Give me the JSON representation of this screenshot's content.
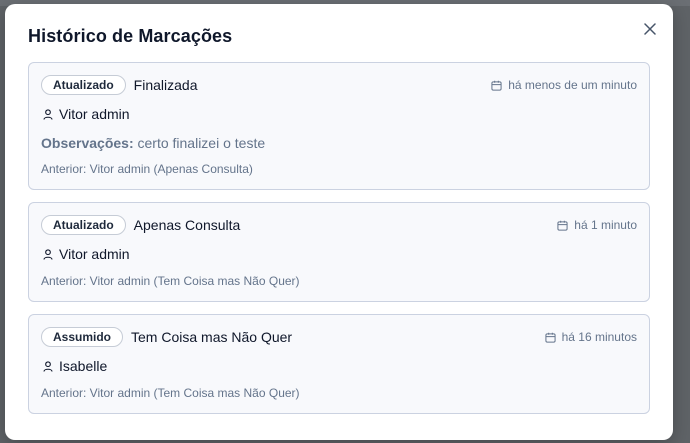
{
  "modal": {
    "title": "Histórico de Marcações",
    "close_icon": "close-icon"
  },
  "entries": [
    {
      "badge": "Atualizado",
      "status": "Finalizada",
      "time": "há menos de um minuto",
      "user": "Vitor admin",
      "observations_label": "Observações:",
      "observations_text": "certo finalizei o teste",
      "previous": "Anterior: Vitor admin (Apenas Consulta)"
    },
    {
      "badge": "Atualizado",
      "status": "Apenas Consulta",
      "time": "há 1 minuto",
      "user": "Vitor admin",
      "previous": "Anterior: Vitor admin (Tem Coisa mas Não Quer)"
    },
    {
      "badge": "Assumido",
      "status": "Tem Coisa mas Não Quer",
      "time": "há 16 minutos",
      "user": "Isabelle",
      "previous": "Anterior: Vitor admin (Tem Coisa mas Não Quer)"
    }
  ],
  "icons": {
    "time": "calendar-icon",
    "user": "user-icon"
  }
}
